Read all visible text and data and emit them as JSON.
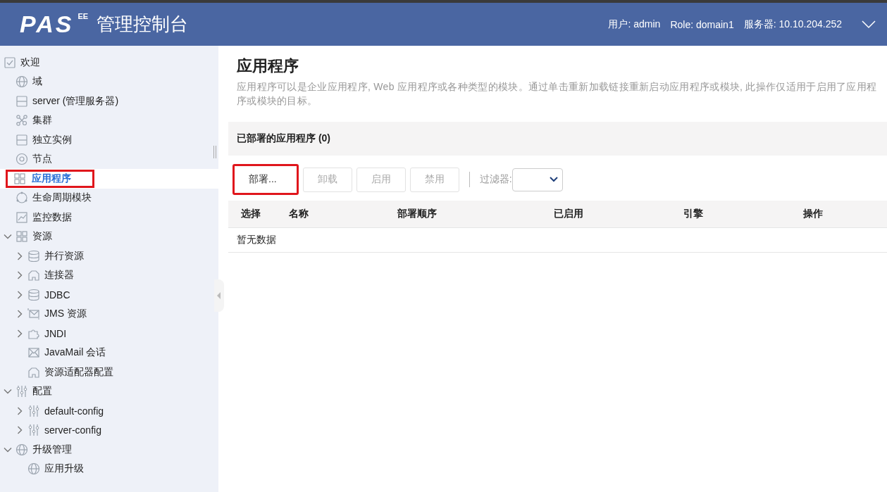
{
  "header": {
    "logo": "PAS",
    "logo_sup": "EE",
    "title": "管理控制台",
    "user": "用户: admin",
    "role": "Role: domain1",
    "server": "服务器: 10.10.204.252"
  },
  "sidebar": {
    "items": [
      {
        "label": "欢迎",
        "kind": "welcome",
        "selected": false,
        "highlighted": false
      },
      {
        "label": "域",
        "kind": "domain",
        "selected": false,
        "highlighted": false
      },
      {
        "label": "server (管理服务器)",
        "kind": "server",
        "selected": false,
        "highlighted": false
      },
      {
        "label": "集群",
        "kind": "cluster",
        "selected": false,
        "highlighted": false
      },
      {
        "label": "独立实例",
        "kind": "server",
        "selected": false,
        "highlighted": false
      },
      {
        "label": "节点",
        "kind": "node",
        "selected": false,
        "highlighted": false
      },
      {
        "label": "应用程序",
        "kind": "application",
        "selected": true,
        "highlighted": true
      },
      {
        "label": "生命周期模块",
        "kind": "lifecycle",
        "selected": false,
        "highlighted": false
      },
      {
        "label": "监控数据",
        "kind": "monitoring",
        "selected": false,
        "highlighted": false
      },
      {
        "label": "资源",
        "kind": "application",
        "selected": false,
        "highlighted": false,
        "expanded": true,
        "children": [
          {
            "label": "并行资源",
            "kind": "database",
            "selected": false,
            "highlighted": false,
            "expanded": false
          },
          {
            "label": "连接器",
            "kind": "connector",
            "selected": false,
            "highlighted": false,
            "expanded": false
          },
          {
            "label": "JDBC",
            "kind": "database",
            "selected": false,
            "highlighted": false,
            "expanded": false
          },
          {
            "label": "JMS 资源",
            "kind": "jms",
            "selected": false,
            "highlighted": false,
            "expanded": false
          },
          {
            "label": "JNDI",
            "kind": "jndi",
            "selected": false,
            "highlighted": false,
            "expanded": false
          },
          {
            "label": "JavaMail 会话",
            "kind": "mail",
            "selected": false,
            "highlighted": false
          },
          {
            "label": "资源适配器配置",
            "kind": "connector",
            "selected": false,
            "highlighted": false
          }
        ]
      },
      {
        "label": "配置",
        "kind": "config",
        "selected": false,
        "highlighted": false,
        "expanded": true,
        "children": [
          {
            "label": "default-config",
            "kind": "config",
            "selected": false,
            "highlighted": false,
            "expanded": false
          },
          {
            "label": "server-config",
            "kind": "config",
            "selected": false,
            "highlighted": false,
            "expanded": false
          }
        ]
      },
      {
        "label": "升级管理",
        "kind": "domain",
        "selected": false,
        "highlighted": false,
        "expanded": true,
        "children": [
          {
            "label": "应用升级",
            "kind": "domain",
            "selected": false,
            "highlighted": false
          }
        ]
      }
    ]
  },
  "page": {
    "title": "应用程序",
    "description": "应用程序可以是企业应用程序, Web 应用程序或各种类型的模块。通过单击重新加载链接重新启动应用程序或模块, 此操作仅适用于启用了应用程序或模块的目标。"
  },
  "panel": {
    "title": "已部署的应用程序 (0)",
    "buttons": [
      {
        "label": "部署...",
        "disabled": false,
        "highlighted": true
      },
      {
        "label": "卸载",
        "disabled": true,
        "highlighted": false
      },
      {
        "label": "启用",
        "disabled": true,
        "highlighted": false
      },
      {
        "label": "禁用",
        "disabled": true,
        "highlighted": false
      }
    ],
    "filter": {
      "label": "过滤器:"
    },
    "table": {
      "columns": [
        "选择",
        "名称",
        "部署顺序",
        "已启用",
        "引擎",
        "操作"
      ],
      "empty_text": "暂无数据"
    }
  }
}
